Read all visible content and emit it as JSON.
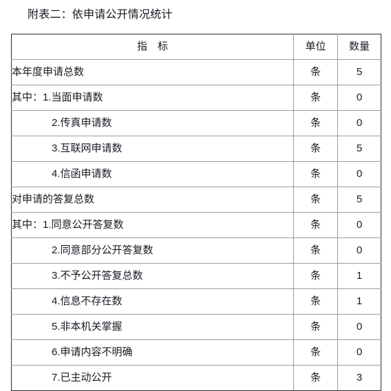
{
  "document": {
    "title": "附表二：依申请公开情况统计"
  },
  "table": {
    "columns": [
      {
        "key": "indicator",
        "label": "指　标"
      },
      {
        "key": "unit",
        "label": "单位"
      },
      {
        "key": "quantity",
        "label": "数量"
      }
    ],
    "rows": [
      {
        "indicator": "本年度申请总数",
        "indent": "top",
        "unit": "条",
        "quantity": "5"
      },
      {
        "indicator": "其中：1.当面申请数",
        "indent": "top",
        "unit": "条",
        "quantity": "0"
      },
      {
        "indicator": "2.传真申请数",
        "indent": "sub",
        "unit": "条",
        "quantity": "0"
      },
      {
        "indicator": "3.互联网申请数",
        "indent": "sub",
        "unit": "条",
        "quantity": "5"
      },
      {
        "indicator": "4.信函申请数",
        "indent": "sub",
        "unit": "条",
        "quantity": "0"
      },
      {
        "indicator": "对申请的答复总数",
        "indent": "top",
        "unit": "条",
        "quantity": "5"
      },
      {
        "indicator": "其中：1.同意公开答复数",
        "indent": "top",
        "unit": "条",
        "quantity": "0"
      },
      {
        "indicator": "2.同意部分公开答复数",
        "indent": "sub",
        "unit": "条",
        "quantity": "0"
      },
      {
        "indicator": "3.不予公开答复总数",
        "indent": "sub",
        "unit": "条",
        "quantity": "1"
      },
      {
        "indicator": "4.信息不存在数",
        "indent": "sub",
        "unit": "条",
        "quantity": "1"
      },
      {
        "indicator": "5.非本机关掌握",
        "indent": "sub",
        "unit": "条",
        "quantity": "0"
      },
      {
        "indicator": "6.申请内容不明确",
        "indent": "sub",
        "unit": "条",
        "quantity": "0"
      },
      {
        "indicator": "7.已主动公开",
        "indent": "sub",
        "unit": "条",
        "quantity": "3"
      }
    ]
  },
  "colors": {
    "text": "#1a1a24",
    "outer_border": "#2b2b2b",
    "inner_border": "#9a9a9a",
    "background": "#ffffff"
  }
}
